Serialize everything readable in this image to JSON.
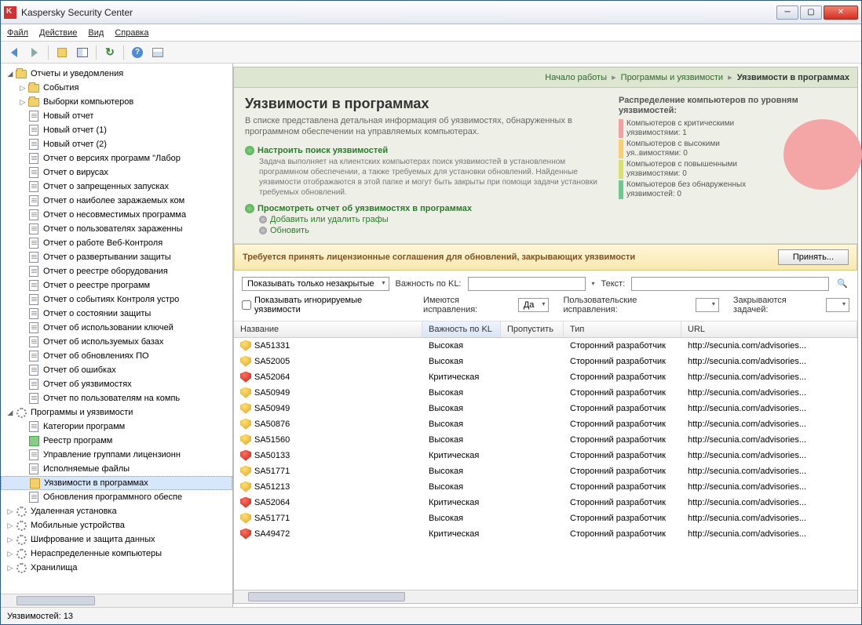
{
  "window": {
    "title": "Kaspersky Security Center"
  },
  "menu": {
    "file": "Файл",
    "action": "Действие",
    "view": "Вид",
    "help": "Справка"
  },
  "tree": {
    "root": "Отчеты и уведомления",
    "n_events": "События",
    "n_selections": "Выборки компьютеров",
    "reports": [
      "Новый отчет",
      "Новый отчет (1)",
      "Новый отчет (2)",
      "Отчет о версиях программ \"Лабор",
      "Отчет о вирусах",
      "Отчет о запрещенных запусках",
      "Отчет о наиболее заражаемых ком",
      "Отчет о несовместимых программа",
      "Отчет о пользователях зараженны",
      "Отчет о работе Веб-Контроля",
      "Отчет о развертывании защиты",
      "Отчет о реестре оборудования",
      "Отчет о реестре программ",
      "Отчет о событиях Контроля устро",
      "Отчет о состоянии защиты",
      "Отчет об использовании ключей",
      "Отчет об используемых базах",
      "Отчет об обновлениях ПО",
      "Отчет об ошибках",
      "Отчет об уязвимостях",
      "Отчет по пользователям на компь"
    ],
    "progs_root": "Программы и уязвимости",
    "progs": [
      "Категории программ",
      "Реестр программ",
      "Управление группами лицензионн",
      "Исполняемые файлы",
      "Уязвимости в программах",
      "Обновления программного обеспе"
    ],
    "others": [
      "Удаленная установка",
      "Мобильные устройства",
      "Шифрование и защита данных",
      "Нераспределенные компьютеры",
      "Хранилища"
    ]
  },
  "breadcrumb": {
    "a": "Начало работы",
    "b": "Программы и уязвимости",
    "c": "Уязвимости в программах"
  },
  "header": {
    "title": "Уязвимости в программах",
    "desc": "В списке представлена детальная информация об уязвимостях, обнаруженных в программном обеспечении на управляемых компьютерах.",
    "act1": "Настроить поиск уязвимостей",
    "act1_desc": "Задача выполняет на клиентских компьютерах поиск уязвимостей в установленном программном обеспечении, а также требуемых для установки обновлений. Найденные уязвимости отображаются в этой папке и могут быть закрыты при помощи задачи установки требуемых обновлений.",
    "act2": "Просмотреть отчет об уязвимостях в программах",
    "sub1": "Добавить или удалить графы",
    "sub2": "Обновить"
  },
  "distro": {
    "title": "Распределение компьютеров по уровням уязвимостей:",
    "rows": [
      {
        "c": "#f4a0a0",
        "t": "Компьютеров с критическими уязвимостями: 1"
      },
      {
        "c": "#f8d070",
        "t": "Компьютеров с высокими уя..вимостями: 0"
      },
      {
        "c": "#d8e070",
        "t": "Компьютеров с повышенными уязвимостями: 0"
      },
      {
        "c": "#70c890",
        "t": "Компьютеров без обнаруженных уязвимостей: 0"
      }
    ]
  },
  "warn": {
    "msg": "Требуется принять лицензионные соглашения для обновлений, закрывающих уязвимости",
    "btn": "Принять..."
  },
  "filters": {
    "show_open": "Показывать только незакрытые",
    "sev_label": "Важность по KL:",
    "text_label": "Текст:",
    "ignore_label": "Показывать игнорируемые уязвимости",
    "has_fix": "Имеются исправления:",
    "has_fix_val": "Да",
    "user_fix": "Пользовательские исправления:",
    "closed_by": "Закрываются задачей:"
  },
  "grid": {
    "cols": [
      "Название",
      "Важность по KL",
      "Пропустить",
      "Тип",
      "URL"
    ],
    "rows": [
      {
        "s": "y",
        "n": "SA51331",
        "v": "Высокая",
        "t": "Сторонний разработчик",
        "u": "http://secunia.com/advisories..."
      },
      {
        "s": "y",
        "n": "SA52005",
        "v": "Высокая",
        "t": "Сторонний разработчик",
        "u": "http://secunia.com/advisories..."
      },
      {
        "s": "r",
        "n": "SA52064",
        "v": "Критическая",
        "t": "Сторонний разработчик",
        "u": "http://secunia.com/advisories..."
      },
      {
        "s": "y",
        "n": "SA50949",
        "v": "Высокая",
        "t": "Сторонний разработчик",
        "u": "http://secunia.com/advisories..."
      },
      {
        "s": "y",
        "n": "SA50949",
        "v": "Высокая",
        "t": "Сторонний разработчик",
        "u": "http://secunia.com/advisories..."
      },
      {
        "s": "y",
        "n": "SA50876",
        "v": "Высокая",
        "t": "Сторонний разработчик",
        "u": "http://secunia.com/advisories..."
      },
      {
        "s": "y",
        "n": "SA51560",
        "v": "Высокая",
        "t": "Сторонний разработчик",
        "u": "http://secunia.com/advisories..."
      },
      {
        "s": "r",
        "n": "SA50133",
        "v": "Критическая",
        "t": "Сторонний разработчик",
        "u": "http://secunia.com/advisories..."
      },
      {
        "s": "y",
        "n": "SA51771",
        "v": "Высокая",
        "t": "Сторонний разработчик",
        "u": "http://secunia.com/advisories..."
      },
      {
        "s": "y",
        "n": "SA51213",
        "v": "Высокая",
        "t": "Сторонний разработчик",
        "u": "http://secunia.com/advisories..."
      },
      {
        "s": "r",
        "n": "SA52064",
        "v": "Критическая",
        "t": "Сторонний разработчик",
        "u": "http://secunia.com/advisories..."
      },
      {
        "s": "y",
        "n": "SA51771",
        "v": "Высокая",
        "t": "Сторонний разработчик",
        "u": "http://secunia.com/advisories..."
      },
      {
        "s": "r",
        "n": "SA49472",
        "v": "Критическая",
        "t": "Сторонний разработчик",
        "u": "http://secunia.com/advisories..."
      }
    ]
  },
  "status": "Уязвимостей: 13"
}
